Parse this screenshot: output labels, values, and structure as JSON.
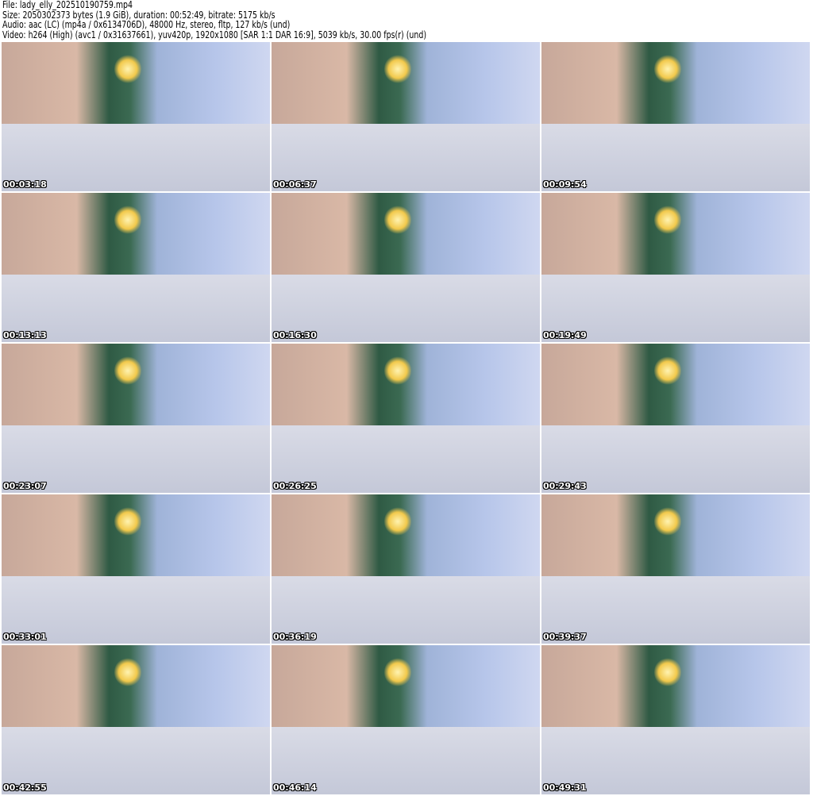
{
  "header": {
    "file": "File: lady_elly_202510190759.mp4",
    "size": "Size: 2050302373 bytes (1.9 GiB), duration: 00:52:49, bitrate: 5175 kb/s",
    "audio": "Audio: aac (LC) (mp4a / 0x6134706D), 48000 Hz, stereo, fltp, 127 kb/s (und)",
    "video": "Video: h264 (High) (avc1 / 0x31637661), yuv420p, 1920x1080 [SAR 1:1 DAR 16:9], 5039 kb/s, 30.00 fps(r) (und)"
  },
  "thumbnails": [
    {
      "timestamp": "00:03:18"
    },
    {
      "timestamp": "00:06:37"
    },
    {
      "timestamp": "00:09:54"
    },
    {
      "timestamp": "00:13:13"
    },
    {
      "timestamp": "00:16:30"
    },
    {
      "timestamp": "00:19:49"
    },
    {
      "timestamp": "00:23:07"
    },
    {
      "timestamp": "00:26:25"
    },
    {
      "timestamp": "00:29:43"
    },
    {
      "timestamp": "00:33:01"
    },
    {
      "timestamp": "00:36:19"
    },
    {
      "timestamp": "00:39:37"
    },
    {
      "timestamp": "00:42:55"
    },
    {
      "timestamp": "00:46:14"
    },
    {
      "timestamp": "00:49:31"
    }
  ]
}
